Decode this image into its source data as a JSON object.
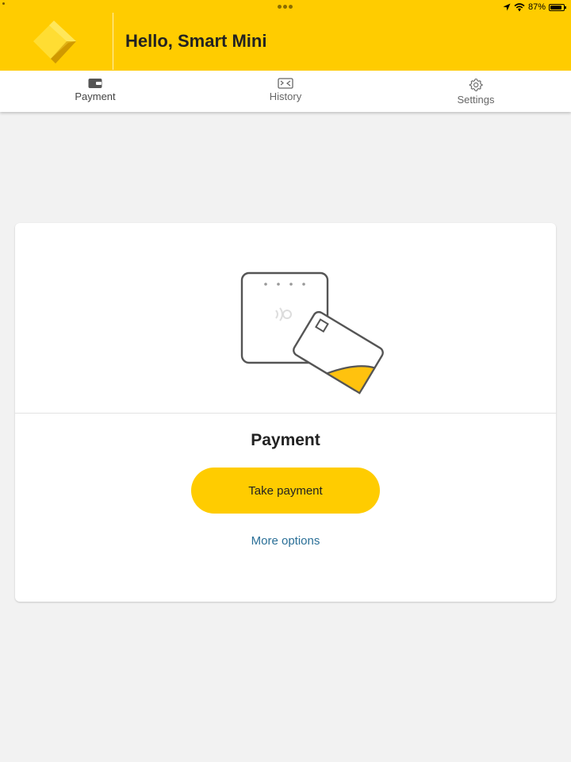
{
  "status_bar": {
    "battery_text": "87%",
    "battery_level": 0.87,
    "icons": [
      "location-arrow-icon",
      "wifi-icon",
      "battery-icon"
    ]
  },
  "header": {
    "greeting": "Hello, Smart Mini",
    "logo": "bank-diamond-logo",
    "background_color": "#ffcc00"
  },
  "tabs": [
    {
      "label": "Payment",
      "icon": "wallet-icon",
      "active": true
    },
    {
      "label": "History",
      "icon": "history-icon",
      "active": false
    },
    {
      "label": "Settings",
      "icon": "gear-icon",
      "active": false
    }
  ],
  "payment_card": {
    "illustration": "terminal-and-card-illustration",
    "title": "Payment",
    "primary_button": "Take payment",
    "secondary_link": "More options"
  },
  "colors": {
    "accent": "#ffcc00",
    "link": "#2a6f97",
    "background": "#f2f2f2"
  }
}
